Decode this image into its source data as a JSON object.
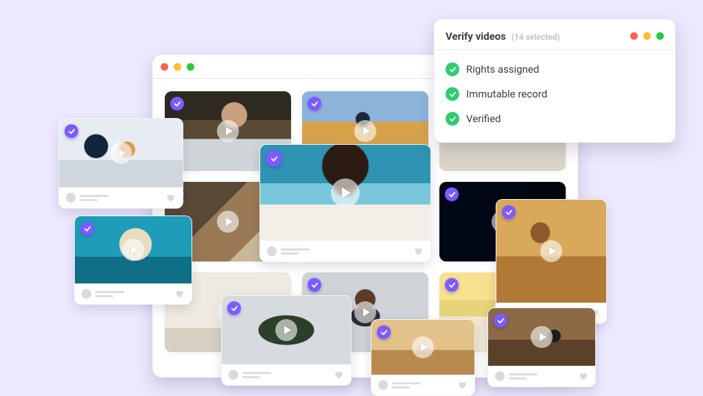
{
  "verify_panel": {
    "title": "Verify videos",
    "subtitle": "(14 selected)",
    "items": [
      {
        "label": "Rights assigned"
      },
      {
        "label": "Immutable record"
      },
      {
        "label": "Verified"
      }
    ]
  },
  "colors": {
    "accent": "#7A5CFF",
    "success": "#2FCC71"
  }
}
